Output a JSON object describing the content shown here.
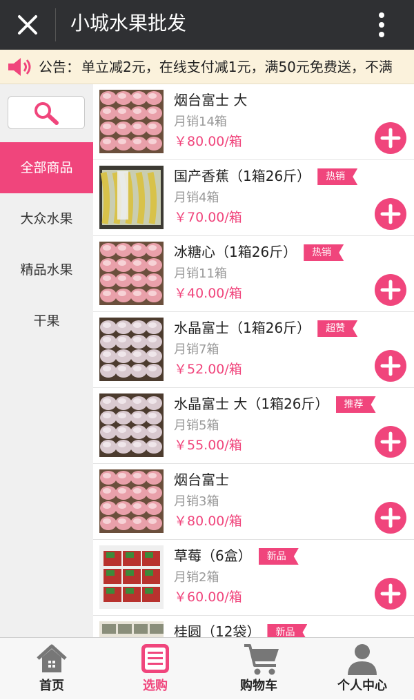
{
  "header": {
    "title": "小城水果批发",
    "close_icon": "close-icon",
    "more_icon": "more-vertical-icon"
  },
  "notice": {
    "label": "公告：",
    "text": "单立减2元，在线支付减1元，满50元免费送，不满"
  },
  "sidebar": {
    "search_icon": "search-icon",
    "categories": [
      {
        "label": "全部商品",
        "active": true
      },
      {
        "label": "大众水果",
        "active": false
      },
      {
        "label": "精品水果",
        "active": false
      },
      {
        "label": "干果",
        "active": false
      }
    ]
  },
  "products": [
    {
      "name": "烟台富士 大",
      "badge": "",
      "sales": "月销14箱",
      "price": "￥80.00/箱",
      "img": "apples"
    },
    {
      "name": "国产香蕉（1箱26斤）",
      "badge": "热销",
      "sales": "月销4箱",
      "price": "￥70.00/箱",
      "img": "bananas"
    },
    {
      "name": "冰糖心（1箱26斤）",
      "badge": "热销",
      "sales": "月销11箱",
      "price": "￥40.00/箱",
      "img": "apples"
    },
    {
      "name": "水晶富士（1箱26斤）",
      "badge": "超赞",
      "sales": "月销7箱",
      "price": "￥52.00/箱",
      "img": "apples-pale"
    },
    {
      "name": "水晶富士 大（1箱26斤）",
      "badge": "推荐",
      "sales": "月销5箱",
      "price": "￥55.00/箱",
      "img": "apples-pale"
    },
    {
      "name": "烟台富士",
      "badge": "",
      "sales": "月销3箱",
      "price": "￥80.00/箱",
      "img": "apples"
    },
    {
      "name": "草莓（6盒）",
      "badge": "新品",
      "sales": "月销2箱",
      "price": "￥60.00/箱",
      "img": "strawberries"
    },
    {
      "name": "桂圆（12袋）",
      "badge": "新品",
      "sales": "",
      "price": "",
      "img": "longan"
    }
  ],
  "tabbar": [
    {
      "label": "首页",
      "icon": "home-icon",
      "active": false
    },
    {
      "label": "选购",
      "icon": "shop-list-icon",
      "active": true
    },
    {
      "label": "购物车",
      "icon": "cart-icon",
      "active": false
    },
    {
      "label": "个人中心",
      "icon": "user-icon",
      "active": false
    }
  ],
  "colors": {
    "accent": "#f0457c",
    "topbar": "#2f3033",
    "notice_bg": "#fbf2dc",
    "sidebar_bg": "#f0f0f0"
  }
}
